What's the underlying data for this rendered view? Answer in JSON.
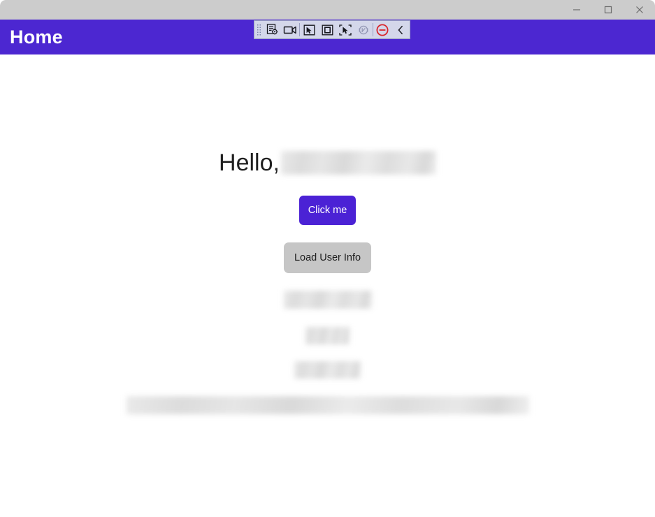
{
  "window": {
    "titlebar_title": "",
    "controls": [
      {
        "name": "minimize",
        "label": "Minimize",
        "glyph": "minimize-icon"
      },
      {
        "name": "maximize",
        "label": "Maximize",
        "glyph": "maximize-icon"
      },
      {
        "name": "close",
        "label": "Close",
        "glyph": "close-icon"
      }
    ]
  },
  "computer_use_toolbar": {
    "handle_label": "drag-handle",
    "buttons": [
      {
        "name": "task-settings",
        "icon": "document-settings-icon",
        "label": "Task settings"
      },
      {
        "name": "record",
        "icon": "video-camera-icon",
        "label": "Record"
      },
      {
        "name": "select-cursor",
        "icon": "cursor-select-icon",
        "label": "Select"
      },
      {
        "name": "select-region",
        "icon": "square-select-icon",
        "label": "Select region"
      },
      {
        "name": "select-element",
        "icon": "cursor-region-icon",
        "label": "Select element"
      },
      {
        "name": "pause-disabled",
        "icon": "pause-circle-icon",
        "label": "Paused"
      },
      {
        "name": "stop",
        "icon": "stop-circle-icon",
        "label": "Stop"
      },
      {
        "name": "collapse",
        "icon": "chevron-left-icon",
        "label": "Collapse toolbar"
      }
    ]
  },
  "app": {
    "header": {
      "title": "Home",
      "background_color": "#4c27d1",
      "title_color": "#ffffff"
    },
    "main": {
      "greeting_prefix": "Hello,",
      "greeting_name_redacted": true,
      "primary_button": {
        "label": "Click me",
        "background_color": "#4b22d5",
        "text_color": "#ffffff"
      },
      "secondary_button": {
        "label": "Load User Info",
        "background_color": "#c6c6c6",
        "text_color": "#1f1f1f"
      },
      "user_info_lines": [
        {
          "name": "user-info-line-1",
          "redacted": true
        },
        {
          "name": "user-info-line-2",
          "redacted": true
        },
        {
          "name": "user-info-line-3",
          "redacted": true
        }
      ],
      "wide_info_bar": {
        "name": "user-info-wide-bar",
        "redacted": true
      }
    }
  }
}
